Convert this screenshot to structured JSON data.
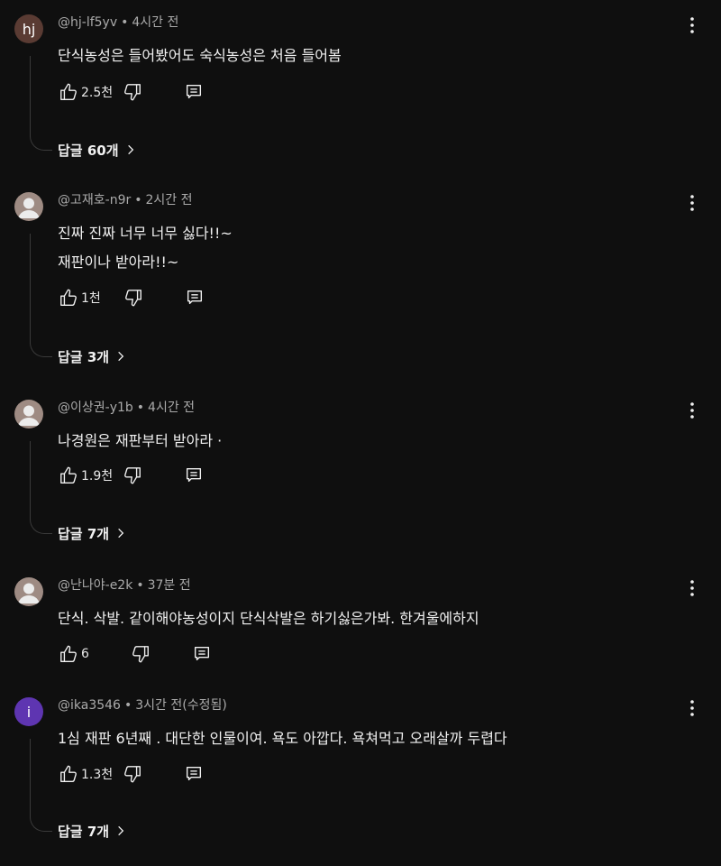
{
  "comments": [
    {
      "avatar_letter": "hj",
      "author": "@hj-lf5yv",
      "time": "4시간 전",
      "lines": [
        "단식농성은 들어봤어도 숙식농성은 처음 들어봄"
      ],
      "likes": "2.5천",
      "replies": "답글 60개"
    },
    {
      "author": "@고재호-n9r",
      "time": "2시간 전",
      "lines": [
        "진짜 진짜 너무 너무 싫다!!~",
        "재판이나 받아라!!~"
      ],
      "likes": "1천",
      "replies": "답글 3개"
    },
    {
      "author": "@이상권-y1b",
      "time": "4시간 전",
      "lines": [
        "나경원은 재판부터 받아라 ·"
      ],
      "likes": "1.9천",
      "replies": "답글 7개"
    },
    {
      "author": "@난나야-e2k",
      "time": "37분 전",
      "lines": [
        "단식. 삭발. 같이해야농성이지 단식삭발은 하기싫은가봐. 한겨울에하지"
      ],
      "likes": "6",
      "replies": ""
    },
    {
      "avatar_letter": "i",
      "author": "@ika3546",
      "time": "3시간 전(수정됨)",
      "lines": [
        "1심 재판  6년째 . 대단한 인물이여. 욕도 아깝다. 욕쳐먹고 오래살까 두렵다"
      ],
      "likes": "1.3천",
      "replies": "답글 7개"
    }
  ],
  "icons": {
    "like": "thumb-up-icon",
    "dislike": "thumb-down-icon",
    "reply": "reply-comment-icon",
    "more": "more-vert-icon",
    "chevron": "chevron-right-icon"
  },
  "colors": {
    "background": "#0f0f0f",
    "text": "#f1f1f1",
    "meta": "#aaaaaa",
    "avatar_hj": "#5a3b33",
    "avatar_i": "#5e35b1"
  }
}
